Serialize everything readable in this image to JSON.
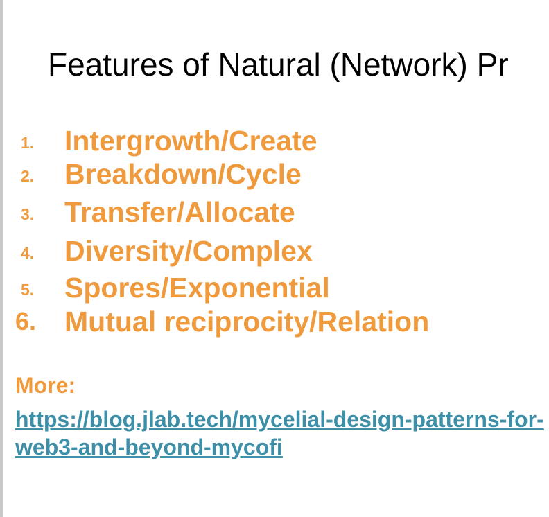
{
  "slide": {
    "title": "Features of Natural (Network) Pr",
    "items": [
      {
        "number": "1.",
        "label": "Intergrowth/Create"
      },
      {
        "number": "2.",
        "label": "Breakdown/Cycle"
      },
      {
        "number": "3.",
        "label": "Transfer/Allocate"
      },
      {
        "number": "4.",
        "label": "Diversity/Complex"
      },
      {
        "number": "5.",
        "label": "Spores/Exponential"
      },
      {
        "number": "6.",
        "label": "Mutual reciprocity/Relation"
      }
    ],
    "more_label": "More:",
    "more_link": "https://blog.jlab.tech/mycelial-design-patterns-for-web3-and-beyond-mycofi"
  },
  "colors": {
    "accent_orange": "#f09a3e",
    "link_teal": "#3d8fa8",
    "title_black": "#000000"
  }
}
